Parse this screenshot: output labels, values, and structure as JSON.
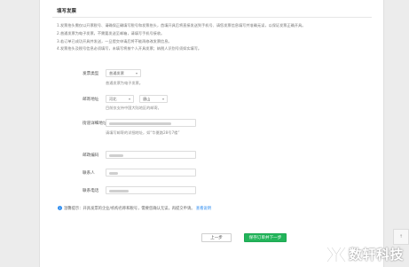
{
  "section": {
    "title": "填写发票"
  },
  "notes": [
    "1.发票抬头需仅以开票税号、请确保正确填写税号和发票抬头，首填开具后将直接发送到手机号、请您发票信息填写并准确无误，以保证发票正确开具。",
    "2.普通发票为电子发票，不需要发送至邮箱，请填写手机号接收。",
    "3.若订单已成功开具并发送，一旦提交申请后将不能再修改发票信息。",
    "4.发票抬头及税号信息必须填写，未填写将按个人开具发票；纳税人识别号须如实填写。"
  ],
  "form": {
    "invoice_type": {
      "label": "发票类型",
      "value": "普通发票",
      "hint": "普通发票为电子发票。"
    },
    "address": {
      "label": "邮寄地址",
      "province": "河北",
      "city": "唐山",
      "hint": "目前仅支持中国大陆地区的邮寄。"
    },
    "detail_address": {
      "label": "街道详细地址",
      "hint": "请填写邮寄的详细地址，如“华夏路28号7楼”"
    },
    "postcode": {
      "label": "邮政编码"
    },
    "contact": {
      "label": "联系人"
    },
    "phone": {
      "label": "联系电话"
    }
  },
  "tip": {
    "text": "温馨提示：开具发票的企业/机构名称和税号，需要您确认无误，再提交申请。",
    "link": "查看说明"
  },
  "buttons": {
    "prev": "上一步",
    "next": "保存订单并下一步"
  },
  "corner": {
    "label": "↑"
  },
  "watermark": {
    "text": "数轩科技",
    "logo": "YX"
  }
}
